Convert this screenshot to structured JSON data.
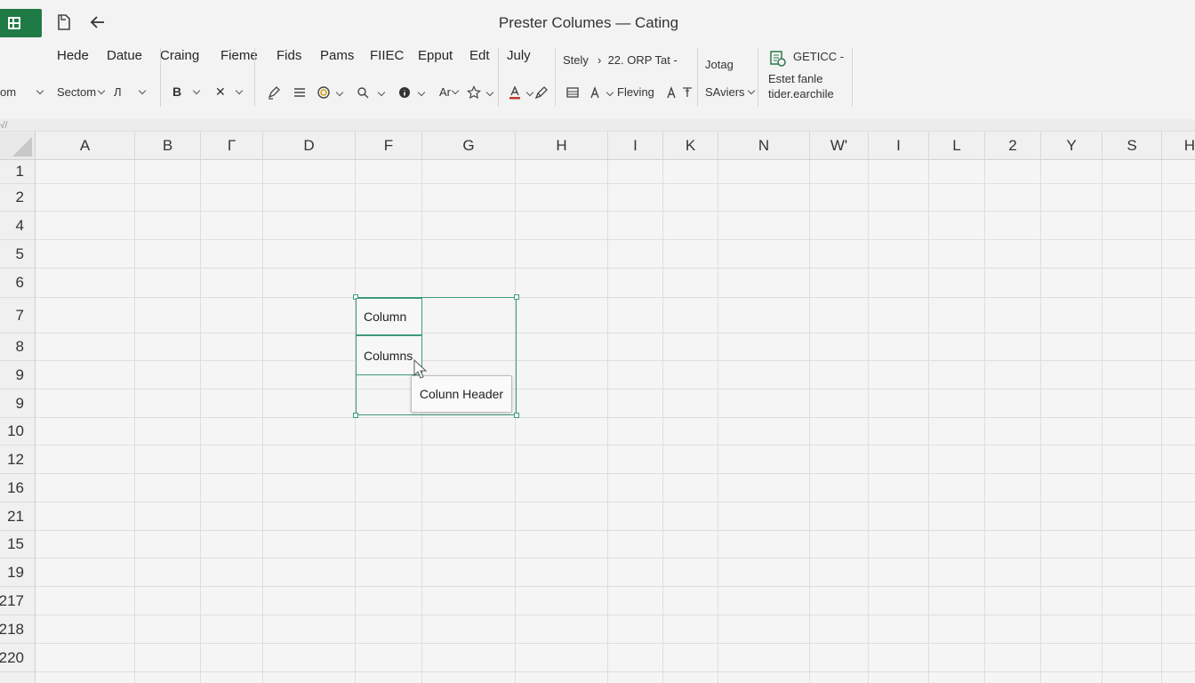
{
  "window": {
    "title": "Prester Columes — Cating"
  },
  "menu": [
    "Hede",
    "Datue",
    "Craing",
    "Fieme",
    "Fids",
    "Pams",
    "FIIEC",
    "Epput",
    "Edt",
    "July"
  ],
  "ribbon": {
    "font_name": "om",
    "style_box": "Sectom",
    "font_size": "Л",
    "align_label": "Ar",
    "fill_label": "Fleving",
    "group_top": "Stely",
    "group_top_value": "22. ORP Tat",
    "jotag": "Jotag",
    "savers": "SAviers",
    "right_top": "GETICC",
    "right_line1": "Estet fanle",
    "right_line2": "tider.earchile",
    "collapse_mark": "√/"
  },
  "columns": [
    "A",
    "B",
    "Г",
    "D",
    "F",
    "G",
    "H",
    "I",
    "K",
    "N",
    "W'",
    "I",
    "L",
    "2",
    "Y",
    "S",
    "H"
  ],
  "rows": [
    "1",
    "2",
    "4",
    "5",
    "6",
    "7",
    "8",
    "9",
    "9",
    "10",
    "12",
    "16",
    "21",
    "15",
    "19",
    "217",
    "218",
    "220"
  ],
  "cells": {
    "f7": "Column",
    "f8": "Columns"
  },
  "tooltip": "Colunn Header",
  "colors": {
    "accent": "#1f7a45",
    "selection": "#3e9a7c",
    "font_color_bar": "#c0392b"
  }
}
